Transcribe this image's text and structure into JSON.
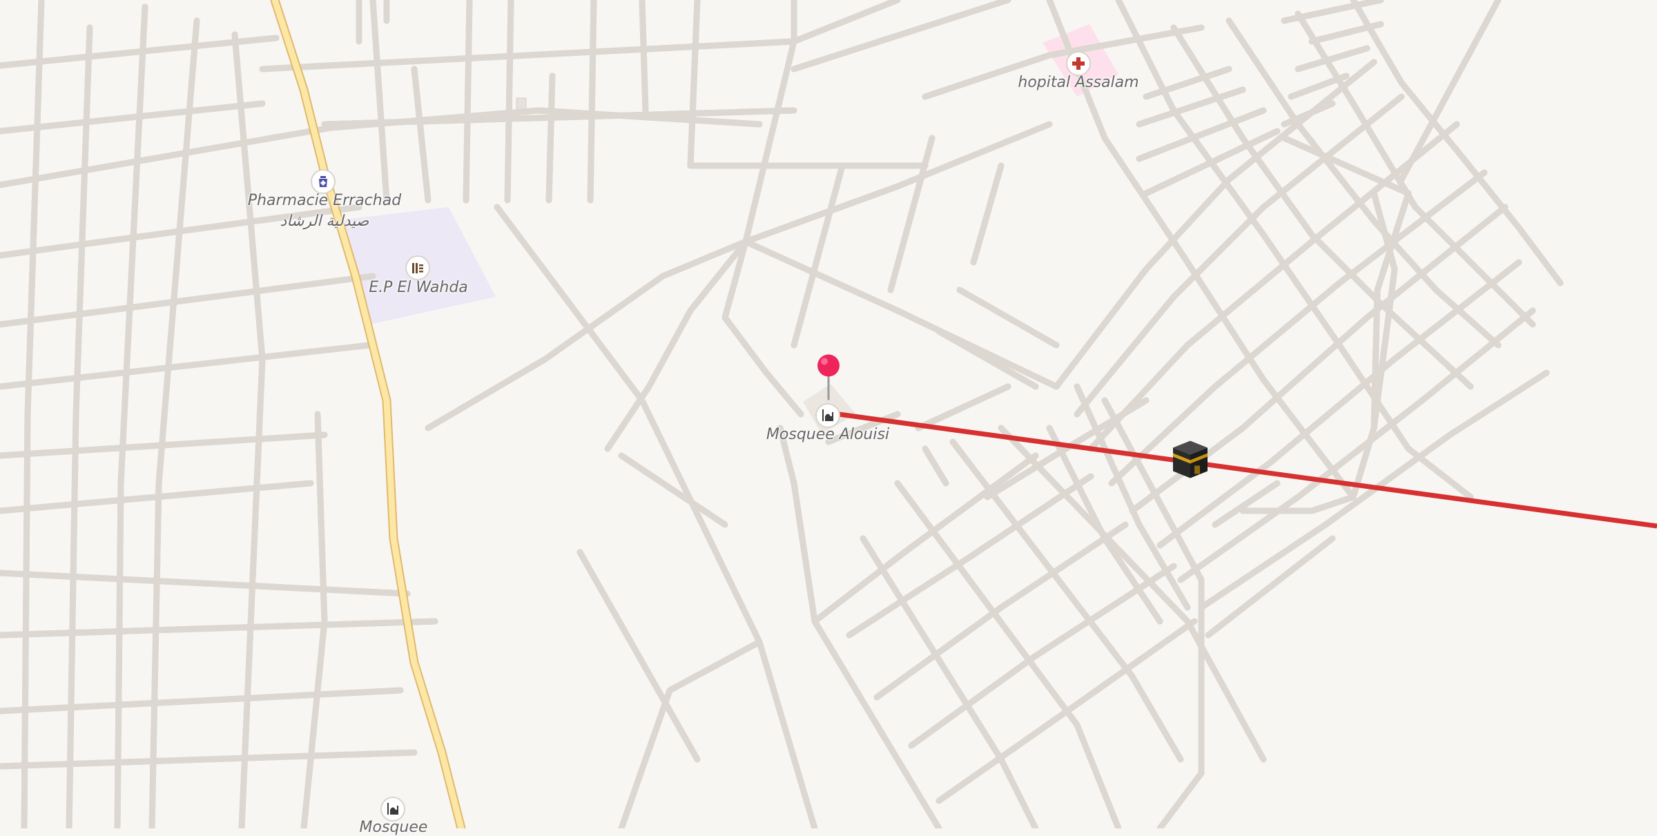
{
  "map": {
    "pois": [
      {
        "id": "pharmacie",
        "name": "Pharmacie Errachad",
        "name_ar": "صيدلية الرشاد",
        "icon": "pharmacy-icon"
      },
      {
        "id": "school",
        "name": "E.P El Wahda",
        "icon": "school-icon"
      },
      {
        "id": "hospital",
        "name": "hopital Assalam",
        "icon": "hospital-icon"
      },
      {
        "id": "mosque_alouisi",
        "name": "Mosquee Alouisi",
        "icon": "mosque-icon"
      },
      {
        "id": "mosque_bottom",
        "name": "Mosquee",
        "icon": "mosque-icon"
      }
    ],
    "location_pin": {
      "icon": "location-pin-icon",
      "color": "#f0245c"
    },
    "qibla_line": {
      "color": "#d63031"
    },
    "kaaba_marker": {
      "icon": "kaaba-icon"
    },
    "colors": {
      "background": "#f8f6f3",
      "road": "#ffffff",
      "road_casing": "#dcd7d0",
      "primary_road": "#fde7a4",
      "primary_road_casing": "#e0b96e",
      "school_area": "#ede8f6",
      "hospital_area": "#fde0ec"
    }
  }
}
